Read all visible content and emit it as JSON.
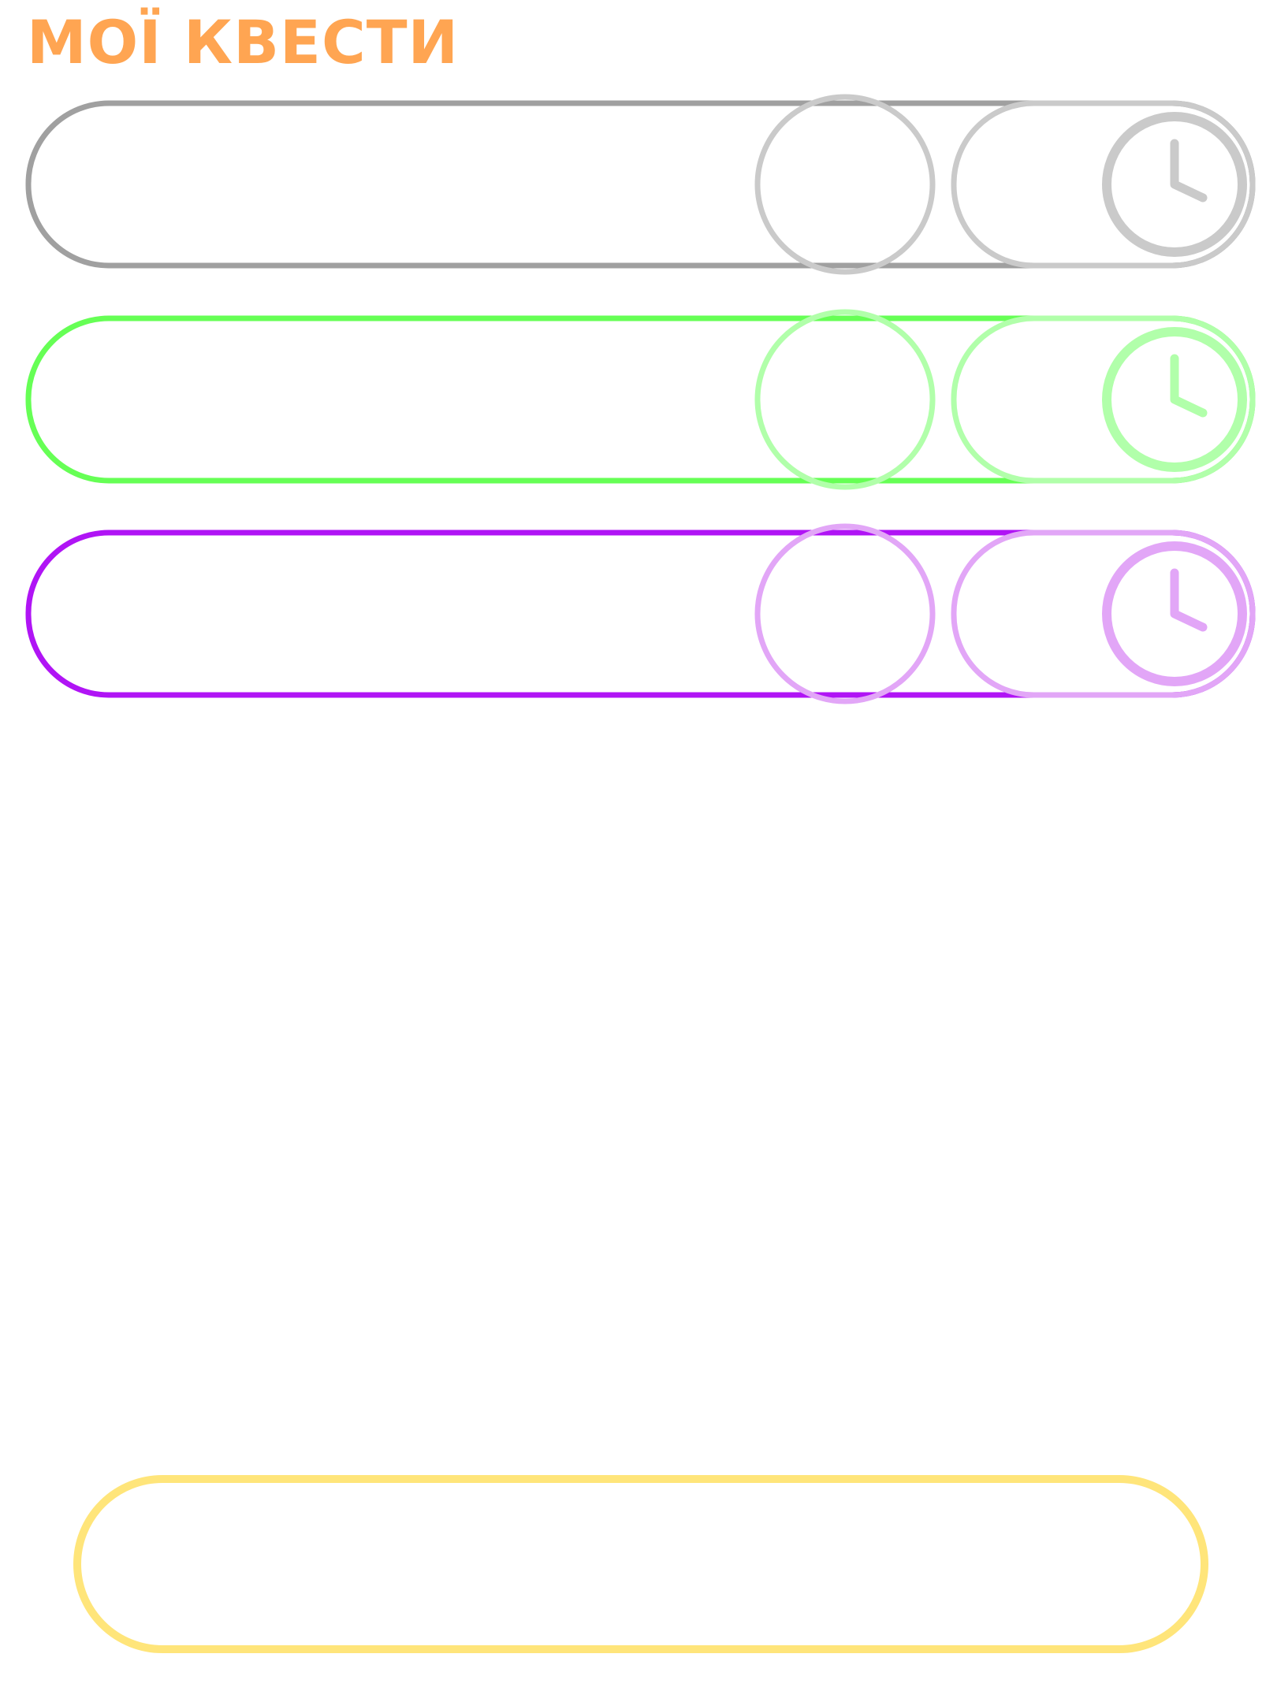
{
  "header": {
    "title": "МОЇ КВЕСТИ",
    "title_color": "#ffa552"
  },
  "quests": [
    {
      "outline_color": "#a0a0a0",
      "control_color": "#cacaca",
      "icon": "clock-icon"
    },
    {
      "outline_color": "#66ff55",
      "control_color": "#b1ffaa",
      "icon": "clock-icon"
    },
    {
      "outline_color": "#b014f5",
      "control_color": "#e2a6f7",
      "icon": "clock-icon"
    }
  ],
  "bottom_action": {
    "outline_color": "#ffe57a"
  }
}
